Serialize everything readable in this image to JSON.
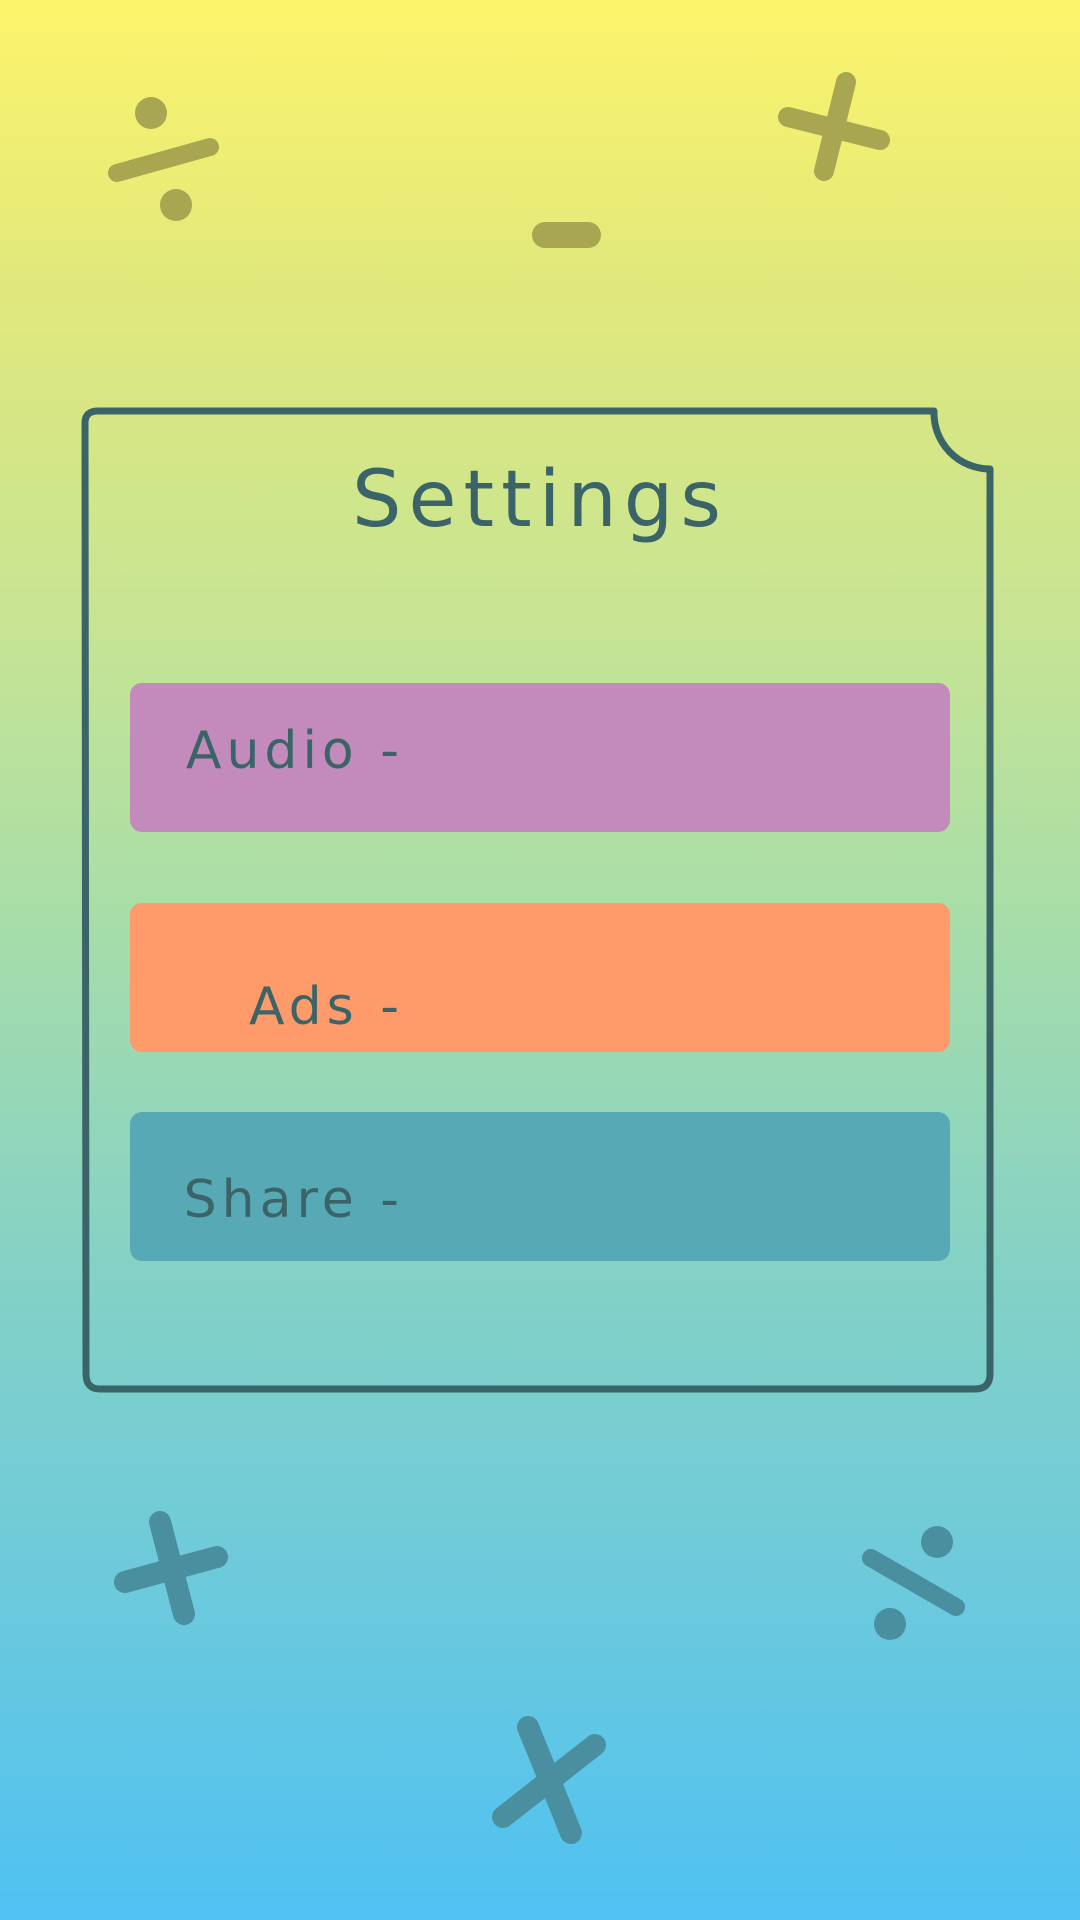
{
  "screen": {
    "title": "Settings",
    "buttons": [
      {
        "label": "Audio -",
        "color": "#c38abc"
      },
      {
        "label": "Ads -",
        "color": "#ff9a6a"
      },
      {
        "label": "Share -",
        "color": "#57a9b5"
      }
    ]
  },
  "decorations": {
    "top_icons": [
      "divide-icon",
      "minus-icon",
      "plus-icon"
    ],
    "bottom_icons": [
      "plus-icon",
      "multiply-icon",
      "divide-icon"
    ]
  },
  "colors": {
    "outline": "#3b6468",
    "top_symbol": "#a8a650",
    "bottom_symbol": "#4a8fa0"
  }
}
